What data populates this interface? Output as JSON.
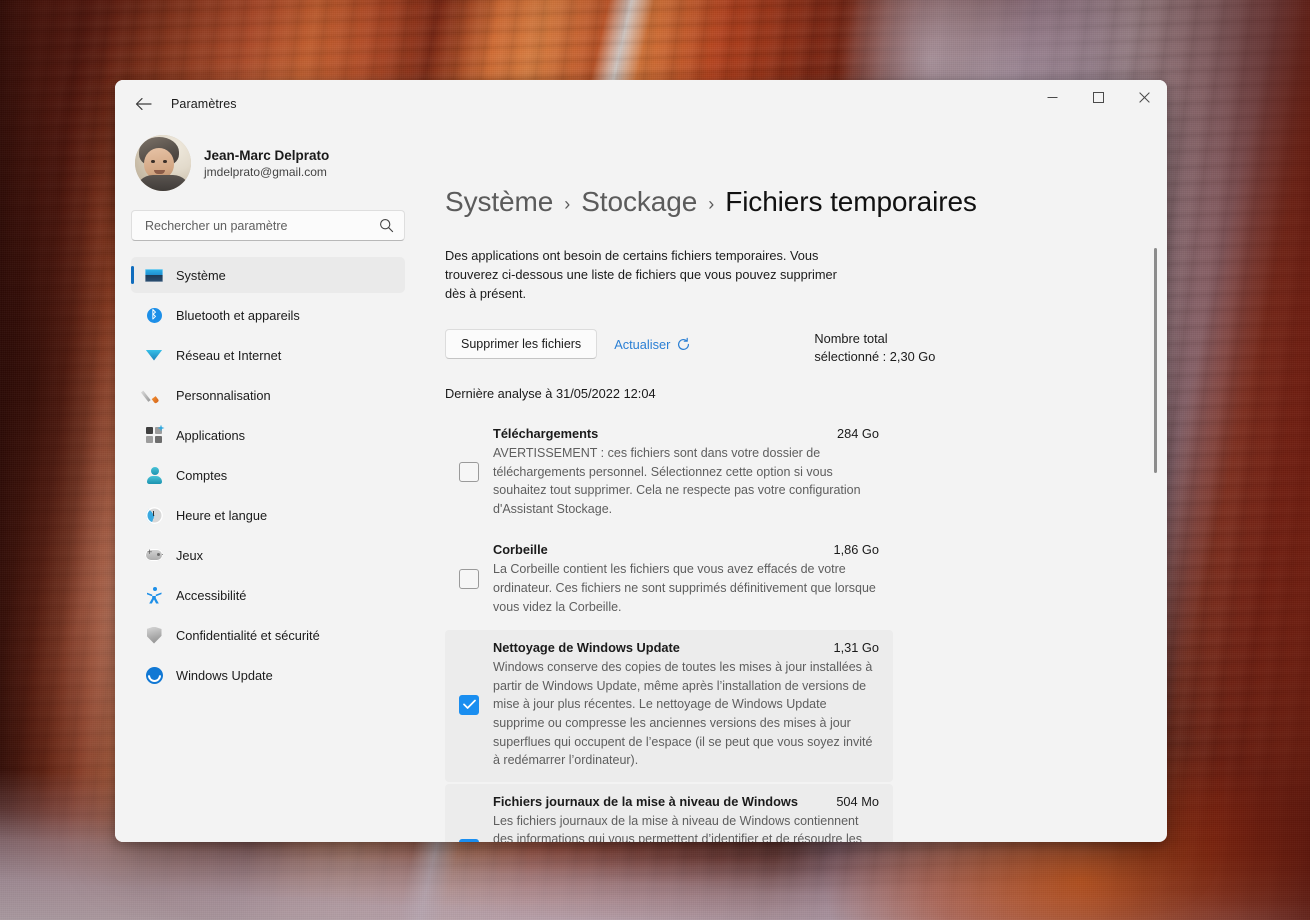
{
  "window": {
    "app_title": "Paramètres",
    "back_icon": "back-arrow-icon",
    "minimize_label": "–",
    "maximize_label": "□",
    "close_label": "×"
  },
  "account": {
    "name": "Jean-Marc Delprato",
    "email": "jmdelprato@gmail.com",
    "avatar_name": "user-avatar"
  },
  "search": {
    "placeholder": "Rechercher un paramètre",
    "value": "",
    "icon": "search-icon"
  },
  "sidebar": {
    "items": [
      {
        "label": "Système",
        "icon": "monitor-icon",
        "selected": true
      },
      {
        "label": "Bluetooth et appareils",
        "icon": "bluetooth-icon",
        "selected": false
      },
      {
        "label": "Réseau et Internet",
        "icon": "wifi-icon",
        "selected": false
      },
      {
        "label": "Personnalisation",
        "icon": "paintbrush-icon",
        "selected": false
      },
      {
        "label": "Applications",
        "icon": "apps-grid-icon",
        "selected": false
      },
      {
        "label": "Comptes",
        "icon": "account-person-icon",
        "selected": false
      },
      {
        "label": "Heure et langue",
        "icon": "clock-icon",
        "selected": false
      },
      {
        "label": "Jeux",
        "icon": "gamepad-icon",
        "selected": false
      },
      {
        "label": "Accessibilité",
        "icon": "accessibility-person-icon",
        "selected": false
      },
      {
        "label": "Confidentialité et sécurité",
        "icon": "shield-icon",
        "selected": false
      },
      {
        "label": "Windows Update",
        "icon": "windows-update-icon",
        "selected": false
      }
    ]
  },
  "breadcrumb": {
    "level1": "Système",
    "sep1": "›",
    "level2": "Stockage",
    "sep2": "›",
    "current": "Fichiers temporaires"
  },
  "main": {
    "intro": "Des applications ont besoin de certains fichiers temporaires. Vous trouverez ci-dessous une liste de fichiers que vous pouvez supprimer dès à présent.",
    "delete_button": "Supprimer les fichiers",
    "refresh_link": "Actualiser",
    "refresh_icon": "refresh-circular-arrow-icon",
    "total_selected": "Nombre total\nsélectionné : 2,30 Go",
    "last_scan": "Dernière analyse à 31/05/2022 12:04"
  },
  "files": [
    {
      "title": "Téléchargements",
      "size": "284 Go",
      "description": "AVERTISSEMENT : ces fichiers sont dans votre dossier de téléchargements personnel. Sélectionnez cette option si vous souhaitez tout supprimer. Cela ne respecte pas votre configuration d'Assistant Stockage.",
      "checked": false
    },
    {
      "title": "Corbeille",
      "size": "1,86 Go",
      "description": "La Corbeille contient les fichiers que vous avez effacés de votre ordinateur. Ces fichiers ne sont supprimés définitivement que lorsque vous videz la Corbeille.",
      "checked": false
    },
    {
      "title": "Nettoyage de Windows Update",
      "size": "1,31 Go",
      "description": "Windows conserve des copies de toutes les mises à jour installées à partir de Windows Update, même après l’installation de versions de mise à jour plus récentes. Le nettoyage de Windows Update supprime ou compresse les anciennes versions des mises à jour superflues qui occupent de l’espace (il se peut que vous soyez invité à redémarrer l’ordinateur).",
      "checked": true
    },
    {
      "title": "Fichiers journaux de la mise à niveau de Windows",
      "size": "504 Mo",
      "description": "Les fichiers journaux de la mise à niveau de Windows contiennent des informations qui vous permettent d’identifier et de résoudre les problèmes qui se produisent lors de l’installation, de la mise à niveau ou de la maintenance de Windows. La suppression de ces fichiers peut compliquer la résolution des problèmes",
      "checked": true
    }
  ],
  "colors": {
    "accent": "#0f6cbd",
    "checkbox_checked": "#1a8ef0",
    "link": "#2a7fd4",
    "window_bg": "#f3f3f3",
    "row_selected_bg": "#ececec"
  }
}
